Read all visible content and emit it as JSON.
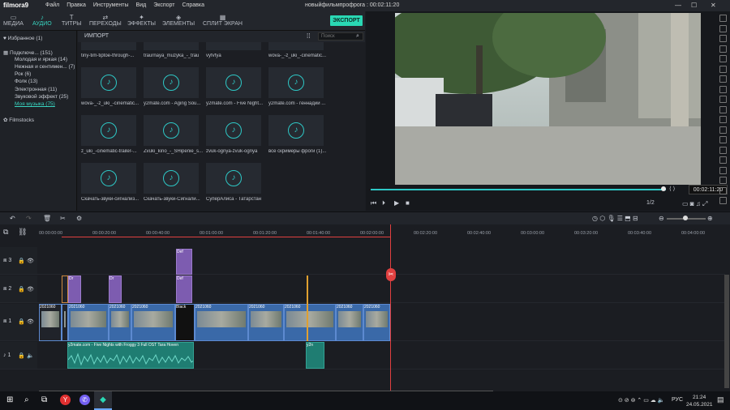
{
  "app": {
    "logo": "filmora9",
    "project_title": "новыйфильмпрофрога : 00:02:11:20"
  },
  "menu": [
    "Файл",
    "Правка",
    "Инструменты",
    "Вид",
    "Экспорт",
    "Справка"
  ],
  "toolbar": {
    "tabs": [
      {
        "label": "МЕДИА",
        "icon": "folder-icon"
      },
      {
        "label": "АУДИО",
        "icon": "music-note-icon"
      },
      {
        "label": "ТИТРЫ",
        "icon": "text-icon"
      },
      {
        "label": "ПЕРЕХОДЫ",
        "icon": "transition-icon"
      },
      {
        "label": "ЭФФЕКТЫ",
        "icon": "effects-icon"
      },
      {
        "label": "ЭЛЕМЕНТЫ",
        "icon": "elements-icon"
      },
      {
        "label": "СПЛИТ ЭКРАН",
        "icon": "split-screen-icon"
      }
    ],
    "export": "ЭКСПОРТ"
  },
  "library": {
    "favorites": "Избранное (1)",
    "connected": "Подключе... (151)",
    "categories": [
      "Молодая и яркая (14)",
      "Нежная и сентимен... (7)",
      "Рок (6)",
      "Фолк (13)",
      "Электронная (11)",
      "Звуковой эффект (25)",
      "Моя музыка (75)"
    ],
    "filmstocks": "Filmstocks"
  },
  "media": {
    "import": "ИМПОРТ",
    "search_placeholder": "Поиск",
    "tiles": [
      "tiny-tim-tiptoe-through-...",
      "traurnaya_muzyka_-_trau",
      "vyfvfya",
      "wova-_-z_uki_-cinematic...",
      "wova-_-z_uki_-cinematic...",
      "y2mate.com - Aging Sou...",
      "y2mate.com - Five Night...",
      "y2mate.com - геннадий ...",
      "z_uki_-cinematic-trailer-...",
      "Zvuki_kino_-_SHipenie_s...",
      "zvuk-ognya-zvuk-ognya",
      "все скримеры фроги (1)...",
      "Скачать-звуки-сигнализ...",
      "Скачать-звуки-Сигнали...",
      "СуперАлиса - Татарстан"
    ]
  },
  "preview": {
    "timecode": "00:02:11:20",
    "ratio": "1/2",
    "progress": 0.94
  },
  "ruler": [
    "00:00:00:00",
    "00:00:20:00",
    "00:00:40:00",
    "00:01:00:00",
    "00:01:20:00",
    "00:01:40:00",
    "00:02:00:00",
    "00:02:20:00",
    "00:02:40:00",
    "00:03:00:00",
    "00:03:20:00",
    "00:03:40:00",
    "00:04:00:00"
  ],
  "tracks": {
    "t3": "3",
    "t2": "2",
    "t1": "1",
    "a1": "1"
  },
  "clips": {
    "title_label": "Def",
    "title_short": "Dr",
    "black": "Black",
    "video_label": "2021060",
    "audio_main": "y2mate.com - Five Nights with Froggy 3 Full OST  Tara Hoven",
    "audio_short": "y2n"
  },
  "taskbar": {
    "lang": "РУС",
    "time": "21:24",
    "date": "24.05.2021"
  },
  "colors": {
    "accent": "#2ad8b4",
    "playhead": "#e04040"
  }
}
